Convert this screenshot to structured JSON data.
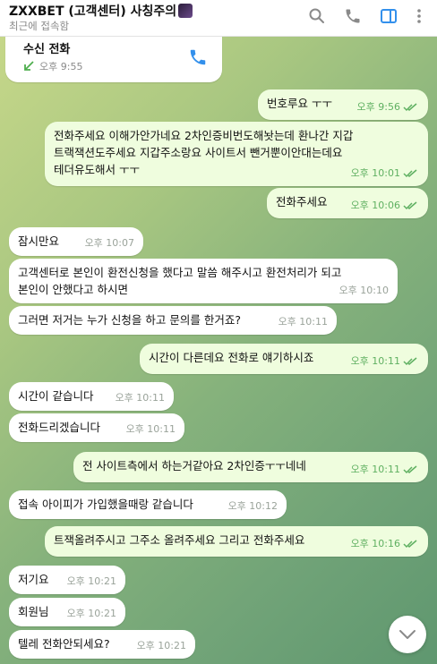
{
  "header": {
    "title": "ZXXBET (고객센터) 사칭주의",
    "subtitle": "최근에 접속함",
    "icons": [
      "search-icon",
      "phone-icon",
      "sidebar-toggle-icon",
      "more-icon"
    ]
  },
  "call_card": {
    "title": "수신 전화",
    "time": "오후 9:55"
  },
  "messages": [
    {
      "text": "번호루요 ㅜㅜ",
      "time": "오후 9:56"
    },
    {
      "text": "전화주세요 이해가안가네요 2차인증비번도해놧는데 환나간 지갑\n트랙잭션도주세요 지갑주소랑요 사이트서 뺀거뿐이안대는데요\n테더유도해서 ㅜㅜ",
      "time": "오후 10:01"
    },
    {
      "text": "전화주세요",
      "time": "오후 10:06"
    },
    {
      "text": "잠시만요",
      "time": "오후 10:07"
    },
    {
      "text": "고객센터로 본인이 환전신청을 했다고 말씀 해주시고 환전처리가 되고\n본인이 안했다고 하시면",
      "time": "오후 10:10"
    },
    {
      "text": "그러면 저거는 누가 신청을 하고 문의를 한거죠?",
      "time": "오후 10:11"
    },
    {
      "text": "시간이 다른데요 전화로 얘기하시죠",
      "time": "오후 10:11"
    },
    {
      "text": "시간이 같습니다",
      "time": "오후 10:11"
    },
    {
      "text": "전화드리겠습니다",
      "time": "오후 10:11"
    },
    {
      "text": "전 사이트측에서 하는거같아요 2차인증ㅜㅜ네네",
      "time": "오후 10:11"
    },
    {
      "text": "접속 아이피가 가입했을때랑 같습니다",
      "time": "오후 10:12"
    },
    {
      "text": "트잭올려주시고 그주소 올려주세요 그리고 전화주세요",
      "time": "오후 10:16"
    },
    {
      "text": "저기요",
      "time": "오후 10:21"
    },
    {
      "text": "회원님",
      "time": "오후 10:21"
    },
    {
      "text": "텔레 전화안되세요?",
      "time": "오후 10:21"
    }
  ],
  "colors": {
    "incoming_bubble": "#ffffff",
    "outgoing_bubble": "#effdde",
    "outgoing_time": "#5fb061",
    "accent": "#3390ec"
  }
}
